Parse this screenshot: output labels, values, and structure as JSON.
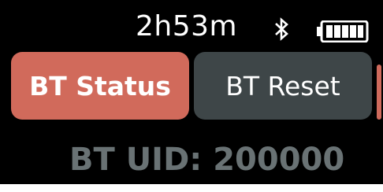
{
  "status_bar": {
    "time": "2h53m",
    "bluetooth_icon": "bluetooth-icon",
    "battery_icon": "battery-full-icon",
    "battery_level": 1.0
  },
  "menu": {
    "items": [
      {
        "label": "BT Status",
        "selected": true
      },
      {
        "label": "BT Reset",
        "selected": false
      }
    ]
  },
  "info": {
    "uid_label": "BT UID:",
    "uid_value": "200000"
  },
  "colors": {
    "selected": "#d16a5b",
    "unselected": "#3e4648",
    "background": "#000000",
    "muted_text": "#697274",
    "scroll_thumb": "#cf6a5c"
  }
}
